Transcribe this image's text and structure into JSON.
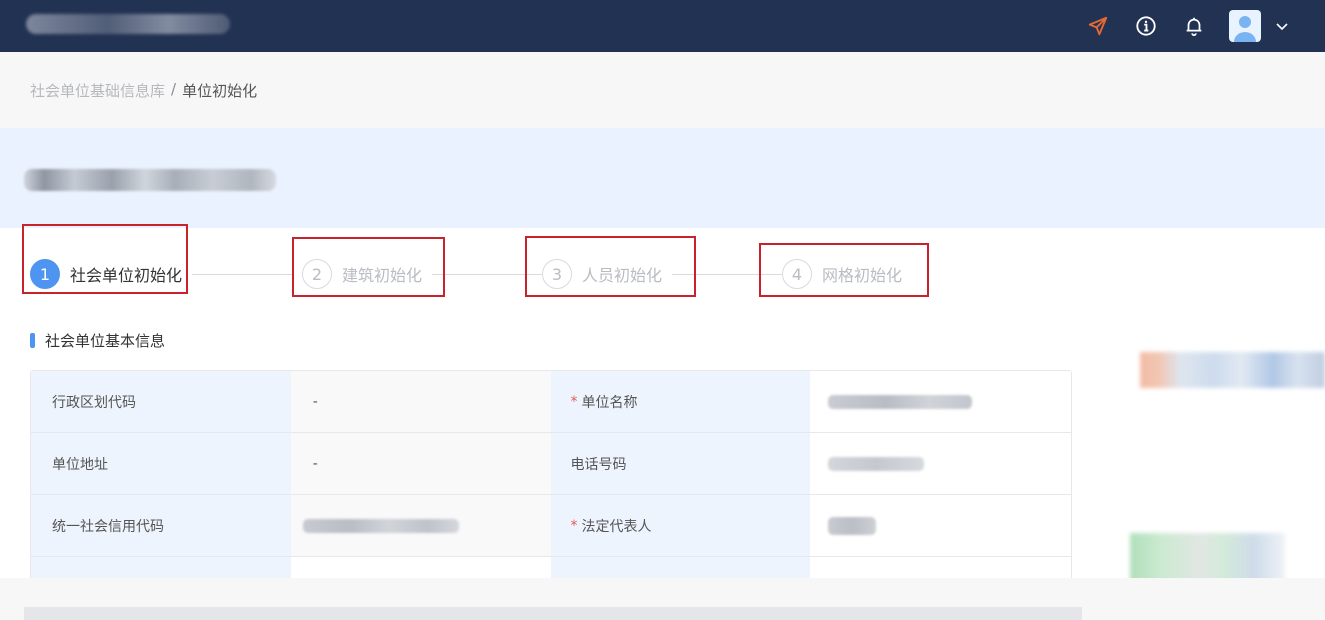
{
  "header": {
    "icons": [
      "send-icon",
      "info-icon",
      "bell-icon",
      "user-avatar-icon",
      "chevron-down-icon"
    ],
    "accent_send_color": "#e8692f"
  },
  "breadcrumb": {
    "parent": "社会单位基础信息库",
    "separator": "/",
    "current": "单位初始化"
  },
  "steps": [
    {
      "num": "1",
      "label": "社会单位初始化"
    },
    {
      "num": "2",
      "label": "建筑初始化"
    },
    {
      "num": "3",
      "label": "人员初始化"
    },
    {
      "num": "4",
      "label": "网格初始化"
    }
  ],
  "section": {
    "title": "社会单位基本信息"
  },
  "table": {
    "rows": [
      {
        "label1": "行政区划代码",
        "value1": "-",
        "required2": "*",
        "label2": "单位名称"
      },
      {
        "label1": "单位地址",
        "value1": "-",
        "label2": "电话号码"
      },
      {
        "label1": "统一社会信用代码",
        "value1": "",
        "required2": "*",
        "label2": "法定代表人"
      }
    ]
  },
  "colors": {
    "topbar": "#223253",
    "primary": "#4d95f0",
    "highlight_box": "#c8232c"
  }
}
